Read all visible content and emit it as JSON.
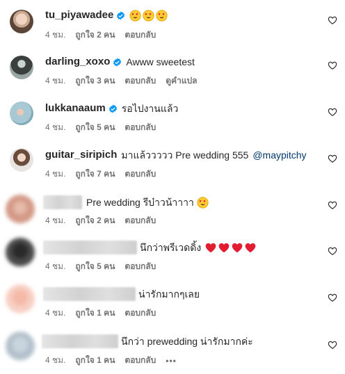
{
  "comments": [
    {
      "username": "tu_piyawadee",
      "verified": true,
      "text": "",
      "emoji_after": 3,
      "time": "4 ชม.",
      "likes": "ถูกใจ 2 คน",
      "reply": "ตอบกลับ",
      "extra": ""
    },
    {
      "username": "darling_xoxo",
      "verified": true,
      "text": "Awww sweetest",
      "time": "4 ชม.",
      "likes": "ถูกใจ 3 คน",
      "reply": "ตอบกลับ",
      "extra": "ดูคำแปล"
    },
    {
      "username": "lukkanaaum",
      "verified": true,
      "text": "รอไปงานแล้ว",
      "time": "4 ชม.",
      "likes": "ถูกใจ 5 คน",
      "reply": "ตอบกลับ",
      "extra": ""
    },
    {
      "username": "guitar_siripich",
      "verified": false,
      "text": "มาแล้ววววว Pre wedding 555",
      "mention": "@maypitchy",
      "time": "4 ชม.",
      "likes": "ถูกใจ 7 คน",
      "reply": "ตอบกลับ",
      "extra": ""
    },
    {
      "username": "",
      "blurred": true,
      "text": "Pre wedding รีบ๋าวน้าาาา",
      "emoji_after": 1,
      "time": "4 ชม.",
      "likes": "ถูกใจ 2 คน",
      "reply": "ตอบกลับ",
      "extra": ""
    },
    {
      "username": "",
      "blurred": true,
      "text": "นึกว่าพรีเวดดิ้ง",
      "hearts_after": 4,
      "time": "4 ชม.",
      "likes": "ถูกใจ 5 คน",
      "reply": "ตอบกลับ",
      "extra": ""
    },
    {
      "username": "",
      "blurred": true,
      "text": "น่ารักมากๆเลย",
      "time": "4 ชม.",
      "likes": "ถูกใจ 1 คน",
      "reply": "ตอบกลับ",
      "extra": ""
    },
    {
      "username": "",
      "blurred": true,
      "text": "นึกว่า prewedding น่ารักมากค่ะ",
      "time": "4 ชม.",
      "likes": "ถูกใจ 1 คน",
      "reply": "ตอบกลับ",
      "extra": "•••"
    }
  ]
}
